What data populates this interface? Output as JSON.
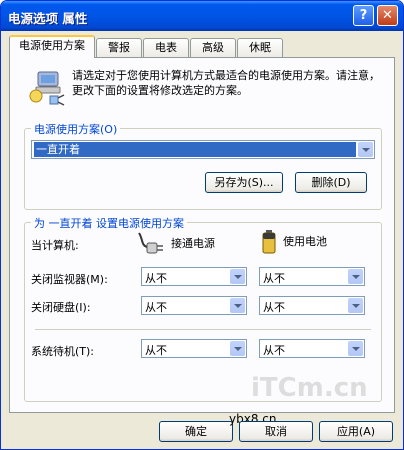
{
  "window": {
    "title": "电源选项 属性",
    "help_label": "?",
    "close_label": "✕"
  },
  "tabs": [
    {
      "label": "电源使用方案",
      "active": true
    },
    {
      "label": "警报",
      "active": false
    },
    {
      "label": "电表",
      "active": false
    },
    {
      "label": "高级",
      "active": false
    },
    {
      "label": "休眠",
      "active": false
    }
  ],
  "intro_text": "请选定对于您使用计算机方式最适合的电源使用方案。请注意，更改下面的设置将修改选定的方案。",
  "schemes": {
    "group_label": "电源使用方案(O)",
    "selected": "一直开着",
    "save_as_label": "另存为(S)...",
    "delete_label": "删除(D)"
  },
  "settings": {
    "group_label": "为 一直开着 设置电源使用方案",
    "computer_label": "当计算机:",
    "ac_label": "接通电源",
    "battery_label": "使用电池",
    "rows": [
      {
        "label": "关闭监视器(M):",
        "ac": "从不",
        "battery": "从不"
      },
      {
        "label": "关闭硬盘(I):",
        "ac": "从不",
        "battery": "从不"
      },
      {
        "label": "系统待机(T):",
        "ac": "从不",
        "battery": "从不"
      }
    ]
  },
  "buttons": {
    "ok": "确定",
    "cancel": "取消",
    "apply": "应用(A)"
  },
  "watermark": {
    "brand": "iTCm.cn",
    "site": "ybx8.cn"
  }
}
